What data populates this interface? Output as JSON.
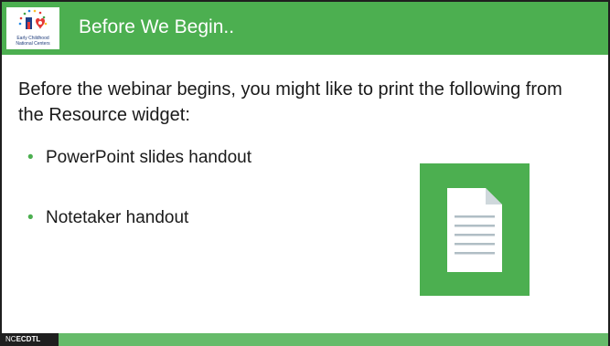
{
  "header": {
    "title": "Before We Begin..",
    "logo": {
      "line1": "Early Childhood",
      "line2": "National Centers",
      "icon": "ecnc-logo-icon"
    }
  },
  "body": {
    "intro": "Before the webinar begins, you might like to print the following from the Resource widget:",
    "bullets": [
      {
        "label": "PowerPoint slides handout"
      },
      {
        "label": "Notetaker handout"
      }
    ]
  },
  "document_tile": {
    "icon": "document-icon"
  },
  "footer": {
    "brand_prefix": "NC",
    "brand_suffix": "ECDTL"
  },
  "colors": {
    "accent_green": "#4caf50",
    "footer_green": "#66bb6a",
    "bullet_green": "#4caf50"
  }
}
